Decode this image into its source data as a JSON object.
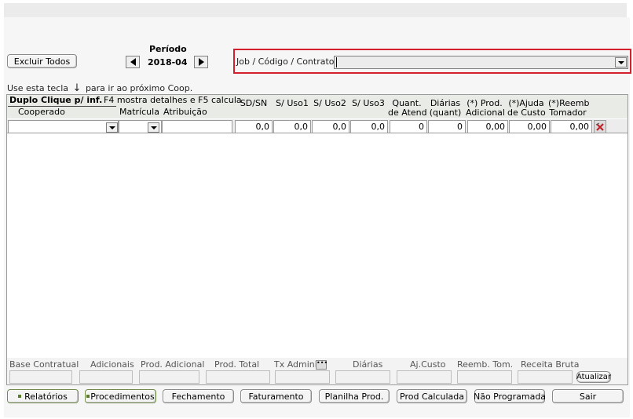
{
  "toolbar": {
    "excluir_label": "Excluir Todos"
  },
  "periodo": {
    "label": "Período",
    "value": "2018-04"
  },
  "job": {
    "label": "Job / Código / Contrato:",
    "value": ""
  },
  "hint": {
    "prefix": "Use esta tecla",
    "suffix": "para ir ao próximo Coop."
  },
  "grid": {
    "header_bold": "Duplo Clique p/ inf.",
    "header_f4": "F4 mostra detalhes e F5 calcula",
    "col_cooperado": "Cooperado",
    "col_matricula": "Matrícula",
    "col_atribuicao": "Atribuição",
    "col_sdsn": "SD/SN",
    "col_uso1": "S/ Uso1",
    "col_uso2": "S/ Uso2",
    "col_uso3": "S/ Uso3",
    "col_quant_1": "Quant.",
    "col_quant_2": "de Atend",
    "col_diarias_1": "Diárias",
    "col_diarias_2": "(quant)",
    "col_prod_1": "(*) Prod.",
    "col_prod_2": "Adicional",
    "col_ajuda_1": "(*)Ajuda",
    "col_ajuda_2": "de Custo",
    "col_reemb_1": "(*)Reemb",
    "col_reemb_2": "Tomador",
    "row": {
      "sdsn": "0,0",
      "uso1": "0,0",
      "uso2": "0,0",
      "uso3": "0,0",
      "quant": "0",
      "diarias": "0",
      "prod": "0,00",
      "ajuda": "0,00",
      "reemb": "0,00"
    }
  },
  "totals": {
    "base": "Base Contratual",
    "adicionais": "Adicionais",
    "prod_adicional": "Prod. Adicional",
    "prod_total": "Prod. Total",
    "tx_admin": "Tx Administ",
    "diarias": "Diárias",
    "aj_custo": "Aj.Custo",
    "reemb_tom": "Reemb. Tom.",
    "receita": "Receita Bruta",
    "atualizar": "Atualizar"
  },
  "bottom_buttons": {
    "relatorios": "Relatórios",
    "procedimentos": "Procedimentos",
    "fechamento": "Fechamento",
    "faturamento": "Faturamento",
    "planilha": "Planilha Prod.",
    "prod_calculada": "Prod Calculada",
    "nao_programada": "Não Programada",
    "sair": "Sair"
  },
  "colors": {
    "accent_border": "#d4202c",
    "button_green": "#5a7d2a",
    "header_bg": "#e9ece6"
  }
}
